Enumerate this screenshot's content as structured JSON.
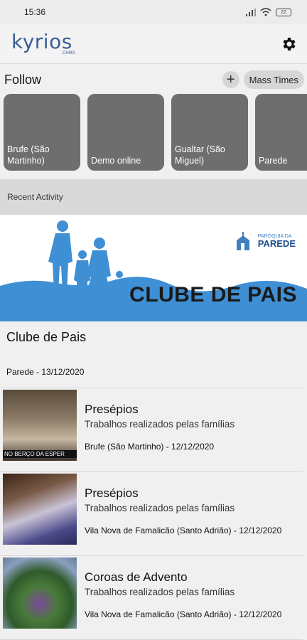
{
  "status_bar": {
    "time": "15:36",
    "battery": "22"
  },
  "header": {
    "logo_text": "kyrios",
    "logo_sub": "CHMS",
    "settings_icon": "gear-icon"
  },
  "follow": {
    "title": "Follow",
    "add_label": "+",
    "mass_times_label": "Mass Times",
    "cards": [
      {
        "label": "Brufe (São Martinho)"
      },
      {
        "label": "Demo online"
      },
      {
        "label": "Gualtar (São Miguel)"
      },
      {
        "label": "Parede"
      }
    ]
  },
  "recent": {
    "title": "Recent Activity"
  },
  "featured": {
    "banner_title": "CLUBE DE PAIS",
    "parish_small": "PARÓQUIA DA",
    "parish_big": "PAREDE",
    "title": "Clube de Pais",
    "meta": "Parede - 13/12/2020"
  },
  "items": [
    {
      "title": "Presépios",
      "subtitle": "Trabalhos realizados pelas famílias",
      "meta": "Brufe (São Martinho) - 12/12/2020",
      "thumb_caption": "NO BERÇO DA ESPER"
    },
    {
      "title": "Presépios",
      "subtitle": "Trabalhos realizados pelas famílias",
      "meta": "Vila Nova de Famalicão (Santo Adrião) - 12/12/2020"
    },
    {
      "title": "Coroas de Advento",
      "subtitle": "Trabalhos realizados pelas famílias",
      "meta": "Vila Nova de Famalicão (Santo Adrião) - 12/12/2020"
    }
  ],
  "colors": {
    "brand": "#3a5f98",
    "banner_blue": "#3f8fd4",
    "card": "#6e6e6e"
  }
}
